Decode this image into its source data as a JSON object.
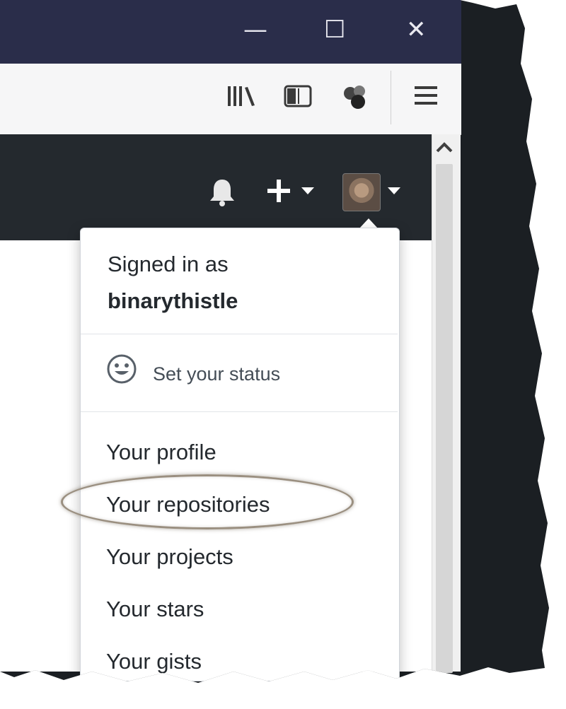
{
  "window": {
    "controls": {
      "minimize": "—",
      "maximize": "☐",
      "close": "✕"
    }
  },
  "browser_toolbar": {
    "icons": [
      "library-icon",
      "sidebar-icon",
      "extensions-icon",
      "menu-icon"
    ]
  },
  "header": {
    "icons": [
      "bell-icon",
      "plus-icon",
      "caret-down-icon",
      "avatar",
      "caret-down-icon"
    ]
  },
  "dropdown": {
    "signed_in_label": "Signed in as",
    "username": "binarythistle",
    "status_label": "Set your status",
    "items": [
      {
        "label": "Your profile"
      },
      {
        "label": "Your repositories",
        "highlighted": true
      },
      {
        "label": "Your projects"
      },
      {
        "label": "Your stars"
      },
      {
        "label": "Your gists"
      }
    ]
  },
  "colors": {
    "titlebar": "#2a2d4a",
    "github_header": "#24292e",
    "highlight_ring": "#9a8f80"
  }
}
